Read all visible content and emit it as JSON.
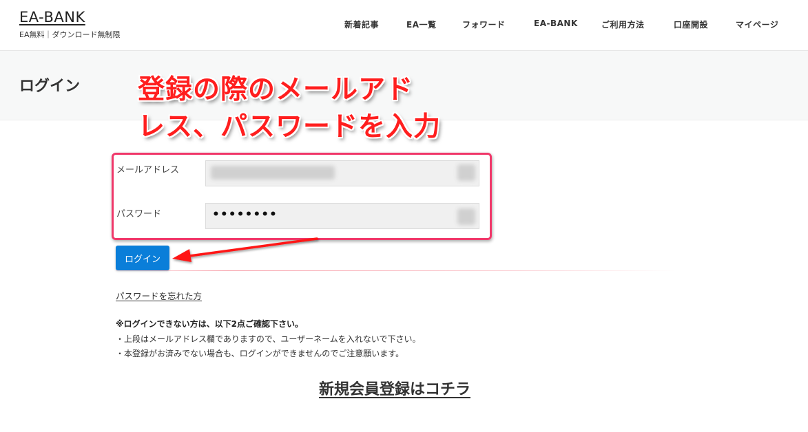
{
  "header": {
    "site_title": "EA-BANK",
    "tagline": "EA無料｜ダウンロード無制限",
    "nav": [
      {
        "label": "新着記事"
      },
      {
        "label": "EA一覧"
      },
      {
        "label": "フォワード"
      },
      {
        "label": "EA-BANK"
      },
      {
        "label": "ご利用方法"
      },
      {
        "label": "口座開設"
      },
      {
        "label": "マイページ"
      }
    ]
  },
  "page": {
    "title": "ログイン"
  },
  "annotation": {
    "line1": "登録の際のメールアド",
    "line2": "レス、パスワードを入力",
    "color": "#ff1e1e",
    "box_color": "#f0386a"
  },
  "form": {
    "email_label": "メールアドレス",
    "email_value": "",
    "password_label": "パスワード",
    "password_value": "••••••••",
    "login_button": "ログイン",
    "button_color": "#0a7ed9"
  },
  "links": {
    "forgot_password": "パスワードを忘れた方",
    "register": "新規会員登録はコチラ"
  },
  "notice": {
    "heading": "※ログインできない方は、以下2点ご確認下さい。",
    "items": [
      "・上段はメールアドレス欄でありますので、ユーザーネームを入れないで下さい。",
      "・本登録がお済みでない場合も、ログインができませんのでご注意願います。"
    ]
  }
}
